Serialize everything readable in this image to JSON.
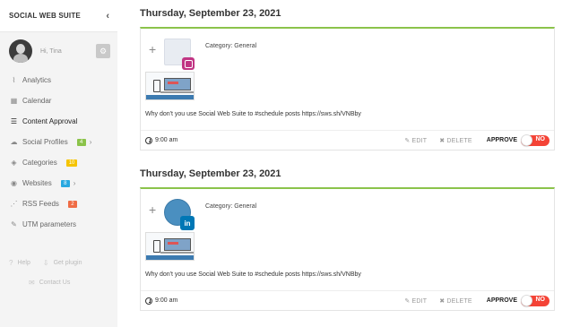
{
  "sidebar": {
    "brand": "SOCIAL WEB SUITE",
    "collapse_icon": "‹",
    "user": {
      "greeting": "Hi, Tina",
      "gear_icon": "⚙"
    },
    "items": [
      {
        "label": "Analytics",
        "icon": "chart-icon",
        "glyph": "⌇"
      },
      {
        "label": "Calendar",
        "icon": "calendar-icon",
        "glyph": "▦"
      },
      {
        "label": "Content Approval",
        "icon": "list-icon",
        "glyph": "☰",
        "active": true
      },
      {
        "label": "Social Profiles",
        "icon": "cloud-icon",
        "glyph": "☁",
        "badge": "4",
        "badge_color": "#8bc34a"
      },
      {
        "label": "Categories",
        "icon": "tag-icon",
        "glyph": "◈",
        "badge": "10",
        "badge_color": "#f5c400"
      },
      {
        "label": "Websites",
        "icon": "globe-icon",
        "glyph": "◉",
        "badge": "8",
        "badge_color": "#29a8e0"
      },
      {
        "label": "RSS Feeds",
        "icon": "rss-icon",
        "glyph": "⋰",
        "badge": "2",
        "badge_color": "#ef6c45"
      },
      {
        "label": "UTM parameters",
        "icon": "link-icon",
        "glyph": "✎"
      }
    ],
    "caret": "›",
    "footer": {
      "help": "Help",
      "get_plugin": "Get plugin",
      "contact": "Contact Us",
      "help_glyph": "?",
      "plugin_glyph": "⇩",
      "contact_glyph": "✉"
    }
  },
  "posts": [
    {
      "date": "Thursday, September 23, 2021",
      "network": "instagram",
      "category": "Category: General",
      "text": "Why don't you use Social Web Suite to #schedule posts https://sws.sh/VNBby",
      "time": "9:00 am",
      "edit": "EDIT",
      "delete": "DELETE",
      "approve": "APPROVE",
      "toggle_state": "NO",
      "plus": "+"
    },
    {
      "date": "Thursday, September 23, 2021",
      "network": "linkedin",
      "category": "Category: General",
      "text": "Why don't you use Social Web Suite to #schedule posts https://sws.sh/VNBby",
      "time": "9:00 am",
      "edit": "EDIT",
      "delete": "DELETE",
      "approve": "APPROVE",
      "toggle_state": "NO",
      "plus": "+",
      "network_label": "in"
    }
  ],
  "colors": {
    "accent": "#8bc34a",
    "toggle_off": "#f44336",
    "sidebar_bg": "#f4f4f4"
  }
}
